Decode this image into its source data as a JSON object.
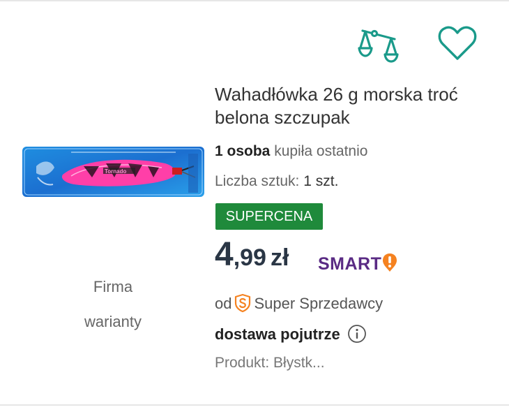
{
  "listing": {
    "title": "Wahadłówka 26 g morska troć belona szczupak",
    "popularity": {
      "count_bold": "1 osoba",
      "text": "kupiła ostatnio"
    },
    "quantity": {
      "label": "Liczba sztuk:",
      "value": "1 szt."
    },
    "badge": "SUPERCENA",
    "price": {
      "whole": "4",
      "fraction": ",99",
      "currency": "zł"
    },
    "smart_label": "SMART",
    "seller": {
      "prefix": "od",
      "text": "Super Sprzedawcy"
    },
    "delivery": "dostawa pojutrze",
    "product_desc": "Produkt: Błystk...",
    "variants": [
      "Firma",
      "warianty"
    ],
    "thumbnail_text": "Tornado",
    "icons": {
      "compare": "scales-compare-icon",
      "wishlist": "heart-outline-icon",
      "smart": "smart-exclamation-icon",
      "super_seller": "super-seller-s-icon",
      "info": "info-circle-icon"
    }
  },
  "colors": {
    "accent": "#1a9a8a",
    "badge_bg": "#1f8a3b",
    "price": "#2a3645",
    "smart_purple": "#5a2b84",
    "smart_orange": "#f58220"
  }
}
